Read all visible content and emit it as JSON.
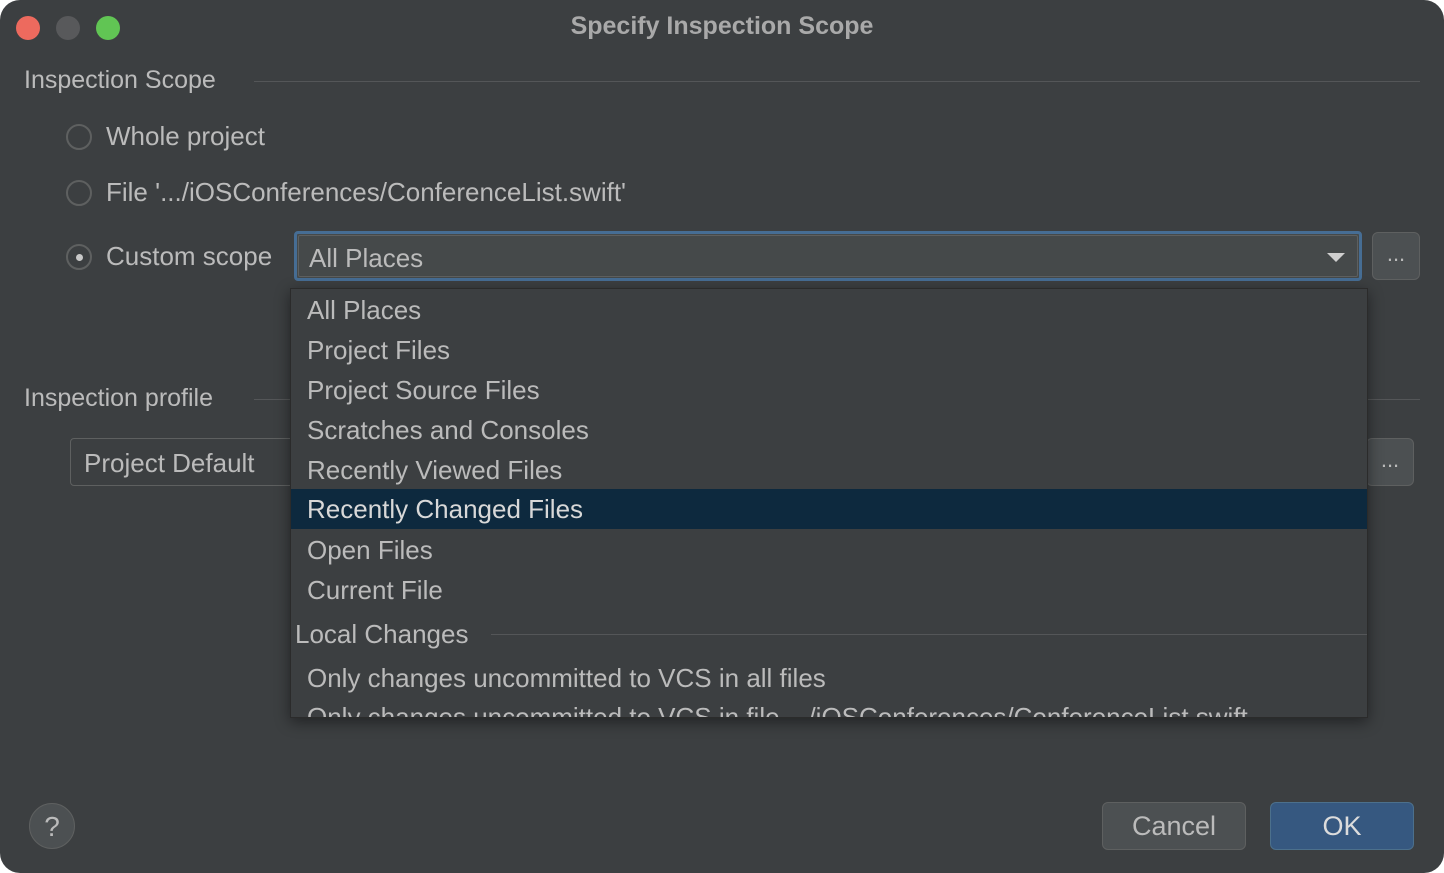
{
  "window": {
    "title": "Specify Inspection Scope"
  },
  "scope_section": {
    "label": "Inspection Scope",
    "options": [
      {
        "label": "Whole project",
        "checked": false
      },
      {
        "label": "File '.../iOSConferences/ConferenceList.swift'",
        "checked": false
      },
      {
        "label": "Custom scope",
        "checked": true
      }
    ],
    "custom_scope_value": "All Places",
    "browse_label": "..."
  },
  "dropdown": {
    "items": [
      "All Places",
      "Project Files",
      "Project Source Files",
      "Scratches and Consoles",
      "Recently Viewed Files",
      "Recently Changed Files",
      "Open Files",
      "Current File"
    ],
    "selected": "Recently Changed Files",
    "group_label": "Local Changes",
    "group_items": [
      "Only changes uncommitted to VCS in all files",
      "Only changes uncommitted to VCS in file .../iOSConferences/ConferenceList.swift"
    ]
  },
  "profile_section": {
    "label": "Inspection profile",
    "value": "Project Default",
    "browse_label": "..."
  },
  "footer": {
    "help_label": "?",
    "cancel_label": "Cancel",
    "ok_label": "OK"
  },
  "colors": {
    "background": "#3c3f41",
    "selection": "#0d293e",
    "focus_border": "#466d94",
    "default_button": "#365880"
  }
}
